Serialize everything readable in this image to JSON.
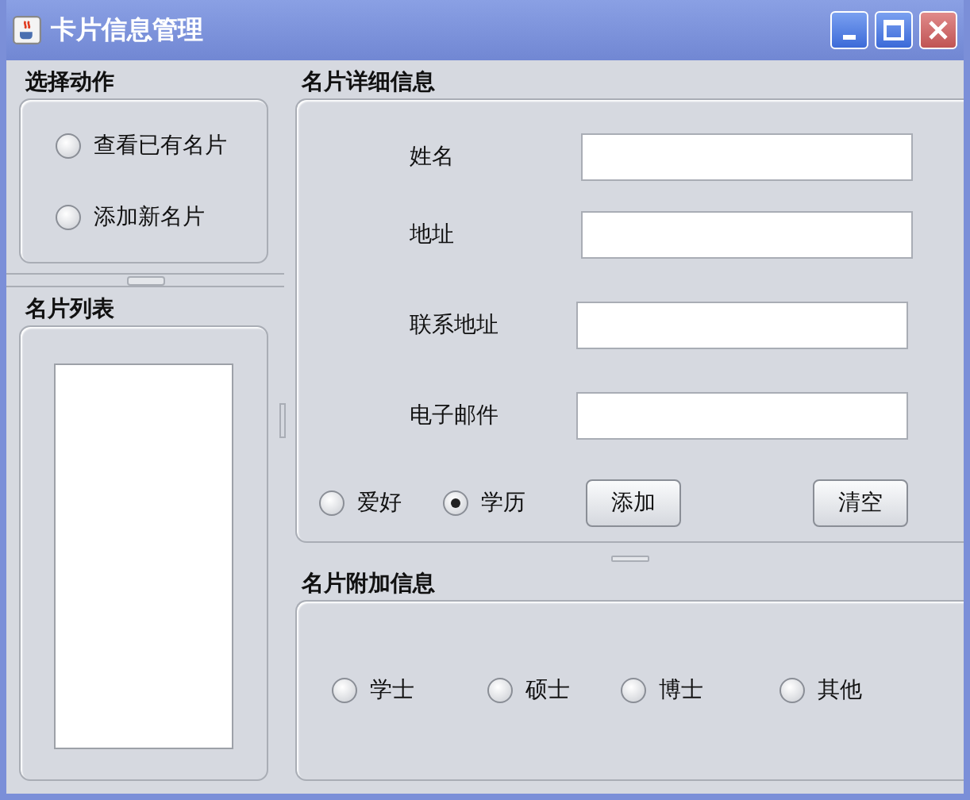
{
  "window": {
    "title": "卡片信息管理"
  },
  "action_group": {
    "title": "选择动作",
    "options": [
      {
        "label": "查看已有名片",
        "selected": false
      },
      {
        "label": "添加新名片",
        "selected": false
      }
    ]
  },
  "list_group": {
    "title": "名片列表"
  },
  "detail_group": {
    "title": "名片详细信息",
    "fields": [
      {
        "label": "姓名"
      },
      {
        "label": "地址"
      },
      {
        "label": "联系地址"
      },
      {
        "label": "电子邮件"
      }
    ],
    "options": [
      {
        "label": "爱好",
        "selected": false
      },
      {
        "label": "学历",
        "selected": true
      }
    ],
    "buttons": [
      "添加",
      "清空"
    ]
  },
  "extra_group": {
    "title": "名片附加信息",
    "options": [
      {
        "label": "学士",
        "selected": false
      },
      {
        "label": "硕士",
        "selected": false
      },
      {
        "label": "博士",
        "selected": false
      },
      {
        "label": "其他",
        "selected": false
      }
    ]
  }
}
